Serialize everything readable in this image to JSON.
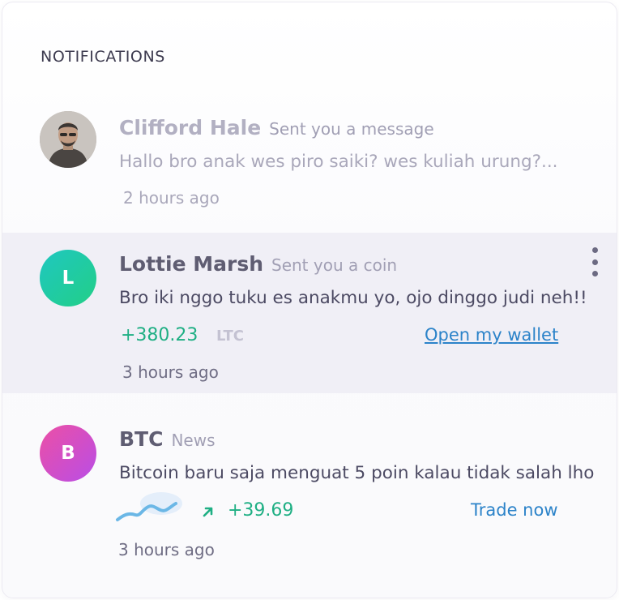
{
  "header": {
    "title": "NOTIFICATIONS"
  },
  "notifications": [
    {
      "avatar_icon": "user-photo",
      "name": "Clifford Hale",
      "action": "Sent you a message",
      "message": "Hallo bro anak wes piro saiki? wes kuliah urung?...",
      "time": "2 hours ago"
    },
    {
      "avatar_letter": "L",
      "name": "Lottie Marsh",
      "action": "Sent you a coin",
      "message": "Bro iki nggo tuku es anakmu yo, ojo dinggo judi neh!!",
      "amount": "+380.23",
      "ticker": "LTC",
      "link": "Open my wallet",
      "time": "3 hours ago"
    },
    {
      "avatar_letter": "B",
      "name": "BTC",
      "action": "News",
      "message": "Bitcoin baru saja menguat 5 poin kalau tidak salah lho",
      "change": "+39.69",
      "link": "Trade now",
      "time": "3 hours ago"
    }
  ],
  "colors": {
    "accent_green": "#1faf84",
    "link_blue": "#2c83c9",
    "avatar_green": "#22cf87",
    "avatar_pink": "#ec4fa5"
  }
}
